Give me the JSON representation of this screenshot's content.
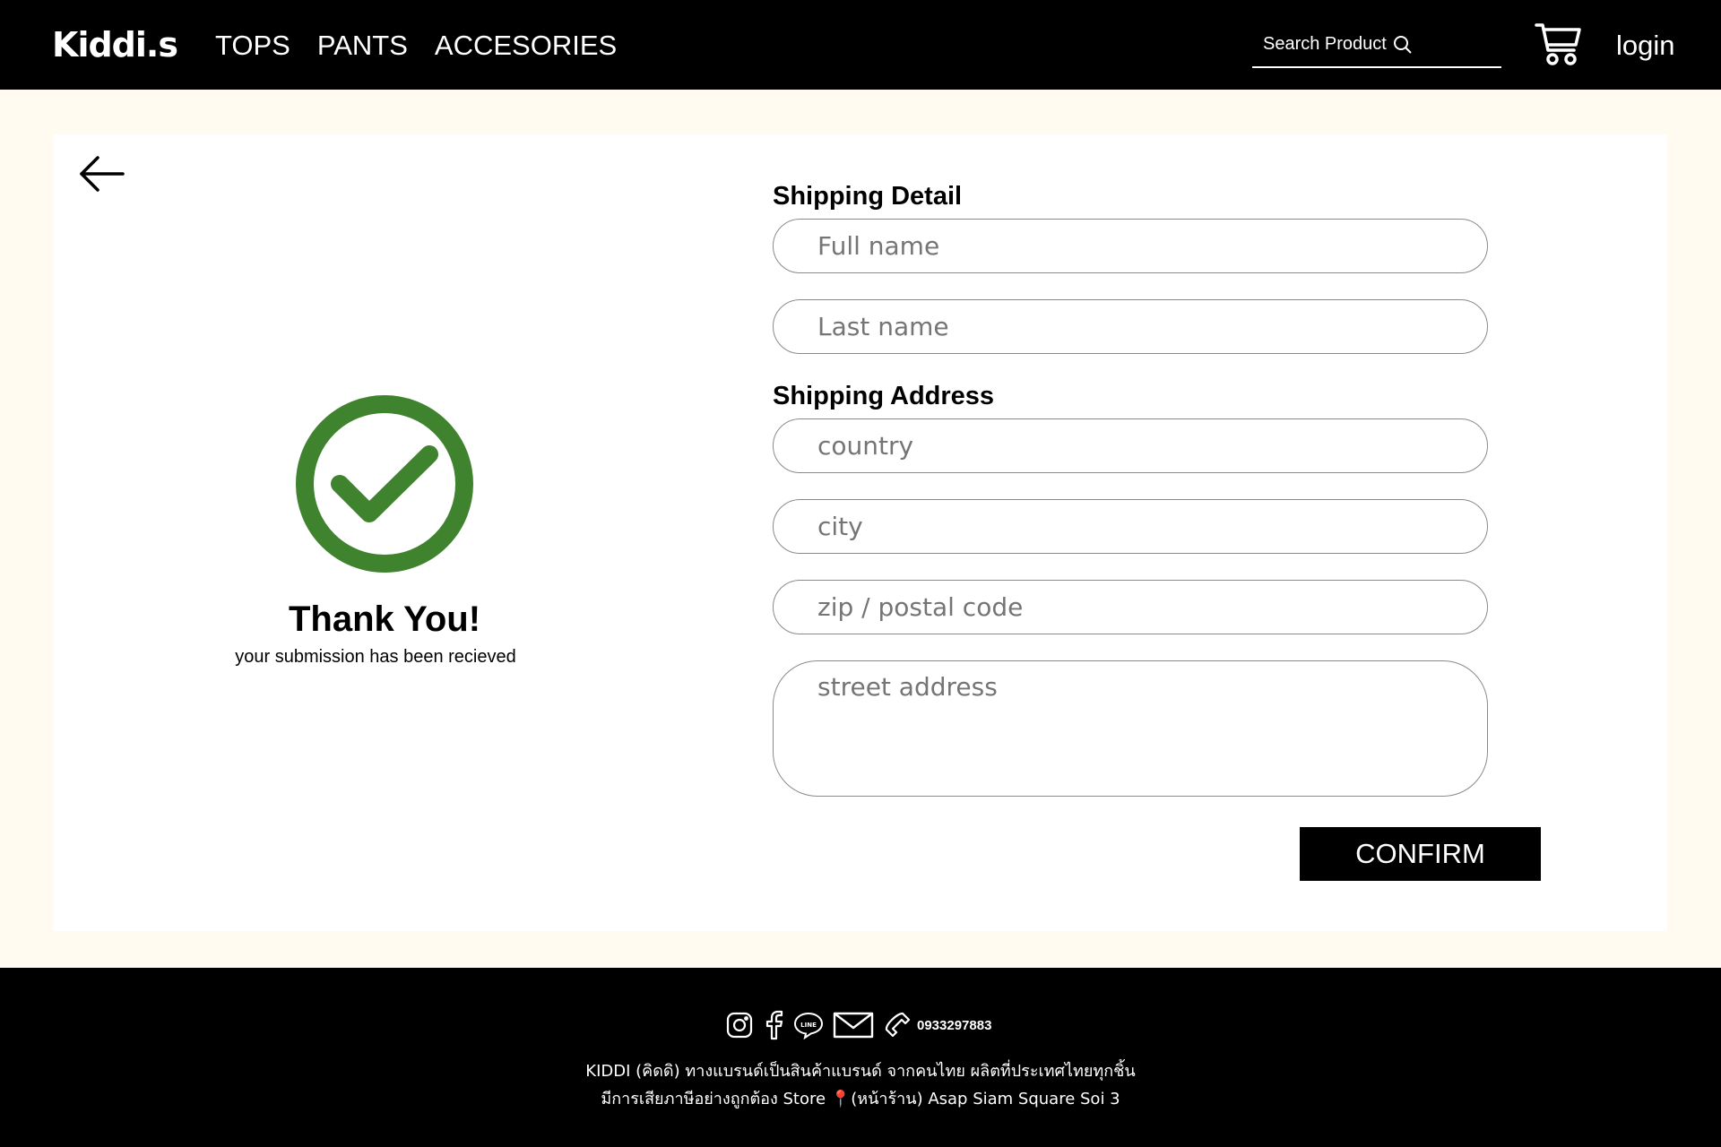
{
  "header": {
    "logo": "Kiddi.s",
    "nav": [
      "TOPS",
      "PANTS",
      "ACCESORIES"
    ],
    "search_placeholder": "Search Product",
    "search_icon": "search-icon",
    "cart_icon": "shopping-cart-icon",
    "login_label": "login"
  },
  "confirmation": {
    "icon": "checkmark-circle-icon",
    "icon_color": "#3f832e",
    "title": "Thank You!",
    "message": "your submission has been recieved"
  },
  "form": {
    "shipping_detail_title": "Shipping Detail",
    "full_name_placeholder": "Full name",
    "last_name_placeholder": "Last name",
    "shipping_address_title": "Shipping Address",
    "country_placeholder": "country",
    "city_placeholder": "city",
    "zip_placeholder": "zip / postal code",
    "street_placeholder": "street address",
    "confirm_label": "CONFIRM"
  },
  "footer": {
    "icons": [
      "instagram-icon",
      "facebook-icon",
      "line-icon",
      "mail-icon",
      "phone-icon"
    ],
    "phone": "0933297883",
    "line1": "KIDDI (คิดดิ) ทางแบรนด์เป็นสินค้าแบรนด์ จากคนไทย ผลิตที่ประเทศไทยทุกชิ้น",
    "line2": "มีการเสียภาษีอย่างถูกต้อง Store 📍(หน้าร้าน) Asap Siam Square Soi 3"
  },
  "colors": {
    "page_background": "#fffbf1",
    "header_background": "#000000",
    "success_green": "#3f832e"
  }
}
